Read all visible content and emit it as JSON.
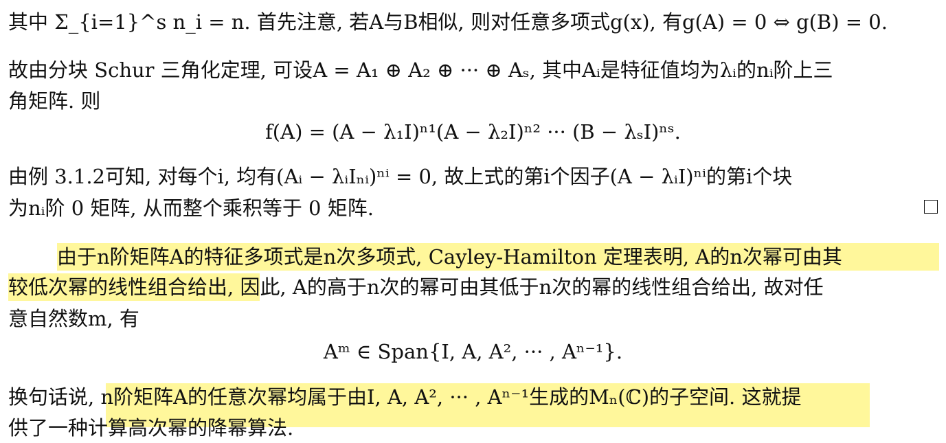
{
  "text": {
    "l1": "其中 Σ_{i=1}^s n_i = n. 首先注意, 若A与B相似, 则对任意多项式g(x), 有g(A) = 0 ⇔ g(B) = 0.",
    "l2": "故由分块 Schur 三角化定理, 可设A = A₁ ⊕ A₂ ⊕ ··· ⊕ Aₛ, 其中Aᵢ是特征值均为λᵢ的nᵢ阶上三",
    "l3": "角矩阵. 则",
    "eq1": "f(A) = (A − λ₁I)ⁿ¹(A − λ₂I)ⁿ² ··· (B − λₛI)ⁿˢ.",
    "l4": "由例 3.1.2可知, 对每个i, 均有(Aᵢ − λᵢIₙᵢ)ⁿⁱ = 0, 故上式的第i个因子(A − λᵢI)ⁿⁱ的第i个块",
    "l5": "为nᵢ阶 0 矩阵, 从而整个乘积等于 0 矩阵.",
    "p2a_highlight": "由于n阶矩阵A的特征多项式是n次多项式, Cayley-Hamilton 定理表明, A的n次幂可由其",
    "p2b_highlight": "较低次幂的线性组合给出",
    "p2b_rest": ", 因此, A的高于n次的幂可由其低于n次的幂的线性组合给出, 故对任",
    "p2c": "意自然数m, 有",
    "eq2": "Aᵐ ∈ Span{I, A, A², ··· , Aⁿ⁻¹}.",
    "p3a_pre": "换句话说, ",
    "p3a_highlight": "n阶矩阵A的任意次幂均属于由I, A, A², ··· , Aⁿ⁻¹生成的Mₙ(ℂ)的子空间.",
    "p3a_post": " 这就提",
    "p3b_highlight": "供了一种计算高次幂的降幂算法."
  },
  "colors": {
    "highlight": "#fff68a",
    "text": "#111111"
  }
}
